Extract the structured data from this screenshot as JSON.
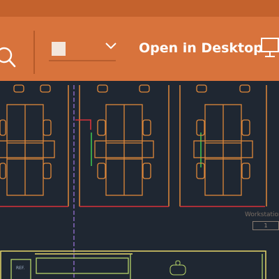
{
  "toolbar": {
    "search_icon": "search-icon",
    "layer_dropdown_icon": "chevron-down-icon",
    "color_swatch": "#f3e6dc",
    "open_in_desktop_label": "Open in Desktop",
    "open_in_desktop_icon": "monitor-icon",
    "accent": "#d8733c"
  },
  "drawing": {
    "background": "#1f2732",
    "workstation_label": "Workstation",
    "workstation_number": "1",
    "ref_label": "REF."
  }
}
